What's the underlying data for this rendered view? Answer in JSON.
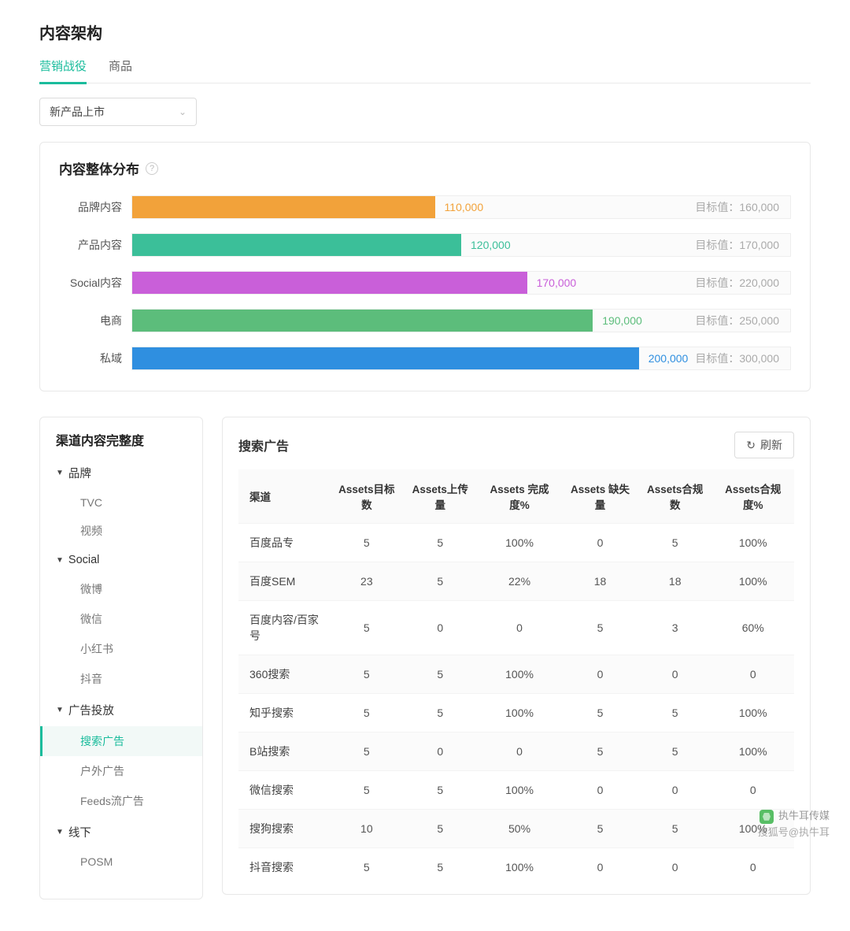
{
  "page_title": "内容架构",
  "tabs": {
    "active": "营销战役",
    "other": "商品"
  },
  "filter_select": "新产品上市",
  "dist_card_title": "内容整体分布",
  "target_prefix": "目标值：",
  "channel_panel_title": "渠道内容完整度",
  "main_panel_title": "搜索广告",
  "refresh_label": "刷新",
  "watermark": {
    "line1": "执牛耳传媒",
    "line2": "搜狐号@执牛耳"
  },
  "chart_data": {
    "type": "bar",
    "title": "内容整体分布",
    "xlabel": "",
    "ylabel": "",
    "xlim": [
      0,
      300000
    ],
    "categories": [
      "品牌内容",
      "产品内容",
      "Social内容",
      "电商",
      "私域"
    ],
    "series": [
      {
        "name": "value",
        "values": [
          110000,
          120000,
          170000,
          190000,
          200000
        ]
      },
      {
        "name": "target",
        "values": [
          160000,
          170000,
          220000,
          250000,
          300000
        ]
      }
    ],
    "colors": [
      "#f2a23a",
      "#3bbf99",
      "#c95fd9",
      "#5cbd7b",
      "#2f8fe0"
    ]
  },
  "bars": [
    {
      "label": "品牌内容",
      "value": "110,000",
      "target": "160,000",
      "pct": 46,
      "color": "#f2a23a",
      "vcolor": "#f2a23a"
    },
    {
      "label": "产品内容",
      "value": "120,000",
      "target": "170,000",
      "pct": 50,
      "color": "#3bbf99",
      "vcolor": "#3bbf99"
    },
    {
      "label": "Social内容",
      "value": "170,000",
      "target": "220,000",
      "pct": 60,
      "color": "#c95fd9",
      "vcolor": "#c95fd9"
    },
    {
      "label": "电商",
      "value": "190,000",
      "target": "250,000",
      "pct": 70,
      "color": "#5cbd7b",
      "vcolor": "#5cbd7b"
    },
    {
      "label": "私域",
      "value": "200,000",
      "target": "300,000",
      "pct": 77,
      "color": "#2f8fe0",
      "vcolor": "#2f8fe0"
    }
  ],
  "tree": [
    {
      "title": "品牌",
      "children": [
        {
          "label": "TVC"
        },
        {
          "label": "视频"
        }
      ]
    },
    {
      "title": "Social",
      "children": [
        {
          "label": "微博"
        },
        {
          "label": "微信"
        },
        {
          "label": "小红书"
        },
        {
          "label": "抖音"
        }
      ]
    },
    {
      "title": "广告投放",
      "children": [
        {
          "label": "搜索广告",
          "active": true
        },
        {
          "label": "户外广告"
        },
        {
          "label": "Feeds流广告"
        }
      ]
    },
    {
      "title": "线下",
      "children": [
        {
          "label": "POSM"
        }
      ]
    }
  ],
  "table": {
    "headers": [
      "渠道",
      "Assets目标数",
      "Assets上传量",
      "Assets 完成度%",
      "Assets 缺失量",
      "Assets合规数",
      "Assets合规度%"
    ],
    "rows": [
      {
        "c": [
          "百度品专",
          "5",
          "5",
          "100%",
          "0",
          "5",
          "100%"
        ],
        "neg": []
      },
      {
        "c": [
          "百度SEM",
          "23",
          "5",
          "22%",
          "18",
          "18",
          "100%"
        ],
        "neg": [
          4
        ]
      },
      {
        "c": [
          "百度内容/百家号",
          "5",
          "0",
          "0",
          "5",
          "3",
          "60%"
        ],
        "neg": [
          4,
          5,
          6
        ]
      },
      {
        "c": [
          "360搜索",
          "5",
          "5",
          "100%",
          "0",
          "0",
          "0"
        ],
        "neg": []
      },
      {
        "c": [
          "知乎搜索",
          "5",
          "5",
          "100%",
          "5",
          "5",
          "100%"
        ],
        "neg": [
          4
        ]
      },
      {
        "c": [
          "B站搜索",
          "5",
          "0",
          "0",
          "5",
          "5",
          "100%"
        ],
        "neg": [
          4
        ]
      },
      {
        "c": [
          "微信搜索",
          "5",
          "5",
          "100%",
          "0",
          "0",
          "0"
        ],
        "neg": []
      },
      {
        "c": [
          "搜狗搜索",
          "10",
          "5",
          "50%",
          "5",
          "5",
          "100%"
        ],
        "neg": [
          4
        ]
      },
      {
        "c": [
          "抖音搜索",
          "5",
          "5",
          "100%",
          "0",
          "0",
          "0"
        ],
        "neg": [
          4
        ]
      }
    ]
  }
}
